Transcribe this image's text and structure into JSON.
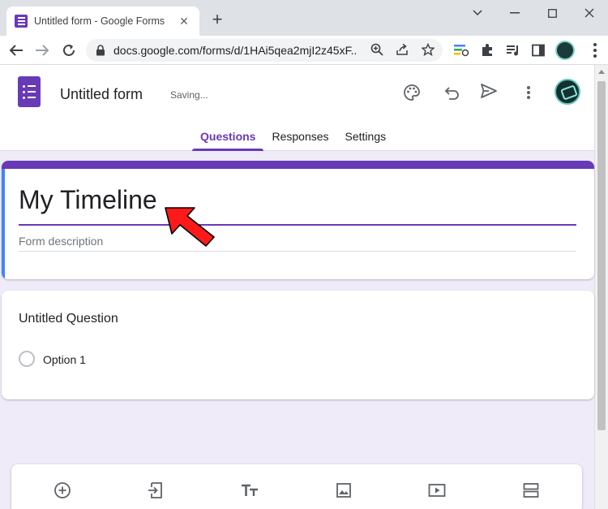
{
  "browser": {
    "tab_title": "Untitled form - Google Forms",
    "tab_close": "✕",
    "new_tab": "+",
    "url": "docs.google.com/forms/d/1HAi5qea2mjI2z45xF..."
  },
  "forms": {
    "form_name": "Untitled form",
    "status": "Saving...",
    "tabs": [
      {
        "label": "Questions",
        "active": true
      },
      {
        "label": "Responses",
        "active": false
      },
      {
        "label": "Settings",
        "active": false
      }
    ],
    "accent_color": "#673ab7"
  },
  "title_card": {
    "title": "My Timeline",
    "description_placeholder": "Form description"
  },
  "question_card": {
    "question_title": "Untitled Question",
    "option_label": "Option 1"
  },
  "bottom_toolbar": {
    "icons": [
      "add-question-icon",
      "import-questions-icon",
      "add-title-icon",
      "add-image-icon",
      "add-video-icon",
      "add-section-icon"
    ]
  },
  "annotation": {
    "arrow_color": "#ff0000"
  }
}
